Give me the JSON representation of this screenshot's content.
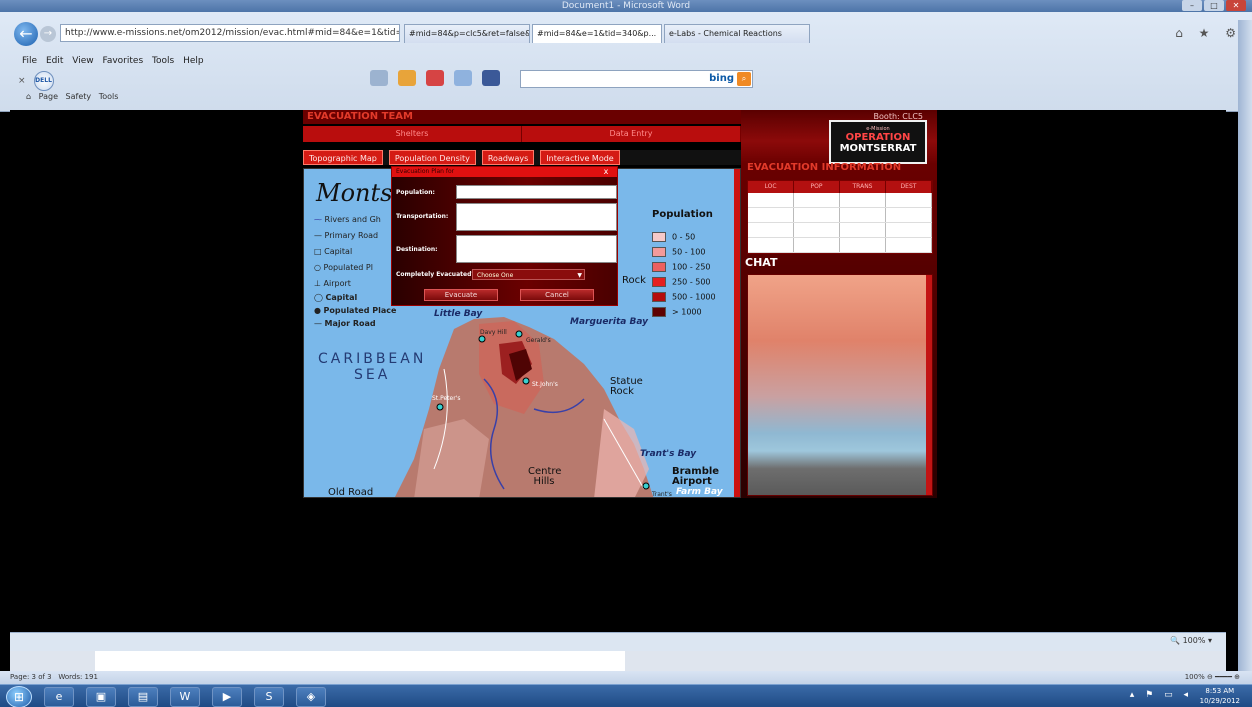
{
  "word_window": {
    "title": "Document1 - Microsoft Word",
    "status_page": "Page: 3 of 3",
    "status_words": "Words: 191",
    "zoom": "100%"
  },
  "browser": {
    "address": "http://www.e-missions.net/om2012/mission/evac.html#mid=84&e=1&tid=34",
    "address_domain": "e-missions.net",
    "tabs": [
      {
        "label": "#mid=84&p=clc5&ret=false&..."
      },
      {
        "label": "#mid=84&e=1&tid=340&p..."
      },
      {
        "label": "e-Labs - Chemical Reactions"
      }
    ],
    "menu": [
      "File",
      "Edit",
      "View",
      "Favorites",
      "Tools",
      "Help"
    ],
    "search_placeholder": "bing",
    "cmdbar": [
      "Page",
      "Safety",
      "Tools"
    ],
    "zoom": "100%",
    "icons": [
      "back-icon",
      "forward-icon",
      "home-icon",
      "favorites-icon",
      "settings-icon"
    ]
  },
  "app": {
    "header": "EVACUATION TEAM",
    "section_tabs": [
      "Shelters",
      "Data Entry"
    ],
    "map_tabs": [
      "Topographic Map",
      "Population Density",
      "Roadways",
      "Interactive Mode"
    ],
    "booth": "Booth: CLC5",
    "logo_top": "e-Mission",
    "logo_line1": "OPERATION",
    "logo_line2": "MONTSERRAT",
    "evac_info_title": "EVACUATION INFORMATION",
    "table_headers": [
      "LOC",
      "POP",
      "TRANS",
      "DEST"
    ],
    "chat_title": "CHAT"
  },
  "map": {
    "title": "Montse",
    "legend": [
      "Rivers and Gh",
      "Primary Road",
      "Capital",
      "Populated Pl",
      "Airport",
      "Capital",
      "Populated Place",
      "Major Road"
    ],
    "sea_line1": "CARIBBEAN",
    "sea_line2": "SEA",
    "population_title": "Population",
    "population_levels": [
      {
        "label": "0 - 50",
        "color": "#f6c9c9"
      },
      {
        "label": "50 - 100",
        "color": "#f39a9a"
      },
      {
        "label": "100 - 250",
        "color": "#ec6060"
      },
      {
        "label": "250 - 500",
        "color": "#e41f1f"
      },
      {
        "label": "500 - 1000",
        "color": "#b50c0c"
      },
      {
        "label": "> 1000",
        "color": "#5e0202"
      }
    ],
    "places": {
      "little_bay": "Little Bay",
      "marguerita_bay": "Marguerita Bay",
      "statue_rock": "Statue Rock",
      "trants_bay": "Trant's Bay",
      "bramble": "Bramble Airport",
      "farm_bay": "Farm Bay",
      "centre_hills": "Centre Hills",
      "old_road": "Old Road",
      "st_johns": "St.John's",
      "st_peters": "St.Peter's",
      "gerald": "Gerald's",
      "davy": "Davy Hill",
      "rock": "Rock",
      "trants": "Trant's"
    }
  },
  "dialog": {
    "header": "Evacuation Plan for",
    "fields": [
      "Population:",
      "Transportation:",
      "Destination:",
      "Completely Evacuated?"
    ],
    "select_value": "Choose One",
    "evacuate_btn": "Evacuate",
    "cancel_btn": "Cancel",
    "close": "x"
  },
  "taskbar": {
    "time": "8:53 AM",
    "date": "10/29/2012"
  }
}
